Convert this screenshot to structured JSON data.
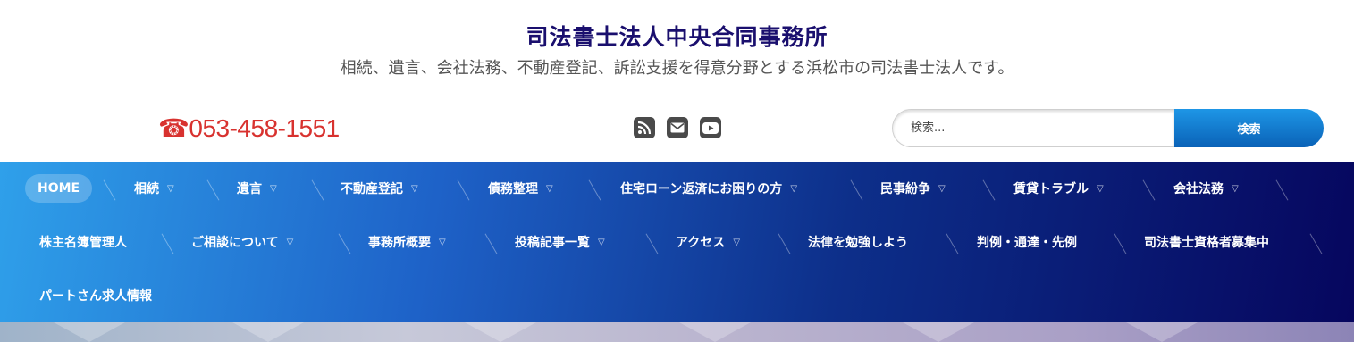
{
  "site": {
    "title": "司法書士法人中央合同事務所",
    "description": "相続、遺言、会社法務、不動産登記、訴訟支援を得意分野とする浜松市の司法書士法人です。"
  },
  "contact": {
    "phone": "☎053-458-1551"
  },
  "social": [
    {
      "icon": "rss-icon"
    },
    {
      "icon": "envelope-icon"
    },
    {
      "icon": "youtube-icon"
    }
  ],
  "search": {
    "placeholder": "検索...",
    "button_label": "検索"
  },
  "colors": {
    "title": "#1a0f6e",
    "phone": "#d8322f",
    "search_button": "#0a62b7",
    "nav_start": "#2fa0ea",
    "nav_end": "#06065e"
  },
  "nav": {
    "items": [
      {
        "label": "HOME",
        "has_dropdown": false,
        "active": true
      },
      {
        "label": "相続",
        "has_dropdown": true
      },
      {
        "label": "遺言",
        "has_dropdown": true
      },
      {
        "label": "不動産登記",
        "has_dropdown": true
      },
      {
        "label": "債務整理",
        "has_dropdown": true
      },
      {
        "label": "住宅ローン返済にお困りの方",
        "has_dropdown": true
      },
      {
        "label": "民事紛争",
        "has_dropdown": true
      },
      {
        "label": "賃貸トラブル",
        "has_dropdown": true
      },
      {
        "label": "会社法務",
        "has_dropdown": true
      },
      {
        "label": "株主名簿管理人",
        "has_dropdown": false
      },
      {
        "label": "ご相談について",
        "has_dropdown": true
      },
      {
        "label": "事務所概要",
        "has_dropdown": true
      },
      {
        "label": "投稿記事一覧",
        "has_dropdown": true
      },
      {
        "label": "アクセス",
        "has_dropdown": true
      },
      {
        "label": "法律を勉強しよう",
        "has_dropdown": false
      },
      {
        "label": "判例・通達・先例",
        "has_dropdown": false
      },
      {
        "label": "司法書士資格者募集中",
        "has_dropdown": false
      },
      {
        "label": "パートさん求人情報",
        "has_dropdown": false
      }
    ]
  }
}
